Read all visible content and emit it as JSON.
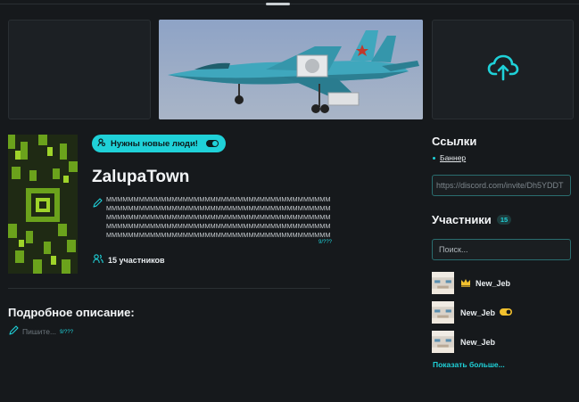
{
  "colors": {
    "background": "#16191c",
    "accent": "#1fd1d8",
    "panel": "#1c2024"
  },
  "upload": {
    "icon": "cloud-upload-icon"
  },
  "badge": {
    "label": "Нужны новые люди!",
    "toggle_on": true
  },
  "town": {
    "title": "ZalupaTown",
    "description": "MMMMMMMMMMMMMMMMMMMMMMMMMMMMMMMMMMMMMMMMMMMMMMMMMMMMMMMMMMMMMMMMMMMMMMMMMMMMMMMMMMMMMMMMMMMMMMMMMMMMMMMMMMMMMMMMMMMMMMMMMMMMMMMMMMMMMMMMMMMMMMMMMMMMMMMMMMMMMMMMMMMMMMMMMMMMMMMMMMMMMMMMMMMMMMMMMMMMMMMMMMMMMMMMMMM",
    "description_counter": "9/???",
    "members_count": "15 участников"
  },
  "details": {
    "title": "Подробное описание:",
    "placeholder": "Пишите...",
    "counter": "9/???"
  },
  "links": {
    "title": "Ссылки",
    "items": [
      {
        "label": "Баннер"
      }
    ],
    "discord_value": "https://discord.com/invite/Dh5YDDT"
  },
  "members": {
    "title": "Участники",
    "count": "15",
    "search_placeholder": "Поиск...",
    "list": [
      {
        "name": "New_Jeb",
        "role_icon": "crown-icon"
      },
      {
        "name": "New_Jeb",
        "role_icon": "toggle-icon"
      },
      {
        "name": "New_Jeb",
        "role_icon": ""
      }
    ],
    "show_more": "Показать больше..."
  }
}
